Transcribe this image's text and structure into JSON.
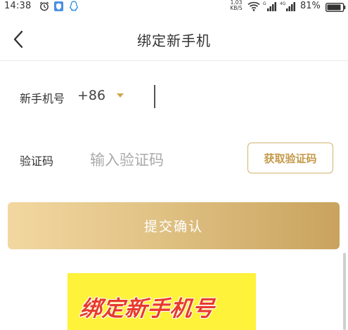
{
  "status_bar": {
    "time": "14:38",
    "net_speed_value": "1.03",
    "net_speed_unit": "KB/S",
    "battery_percent": "81%"
  },
  "nav": {
    "title": "绑定新手机"
  },
  "form": {
    "phone_label": "新手机号",
    "country_code": "+86",
    "phone_value": "",
    "code_label": "验证码",
    "code_placeholder": "输入验证码",
    "get_code_label": "获取验证码",
    "submit_label": "提交确认"
  },
  "banner": {
    "text": "绑定新手机号"
  },
  "colors": {
    "accent": "#c49a4a",
    "button_gradient_start": "#f2d7a0",
    "button_gradient_end": "#c9a35e",
    "banner_bg": "#fff23a",
    "banner_text": "#e83a2b"
  }
}
